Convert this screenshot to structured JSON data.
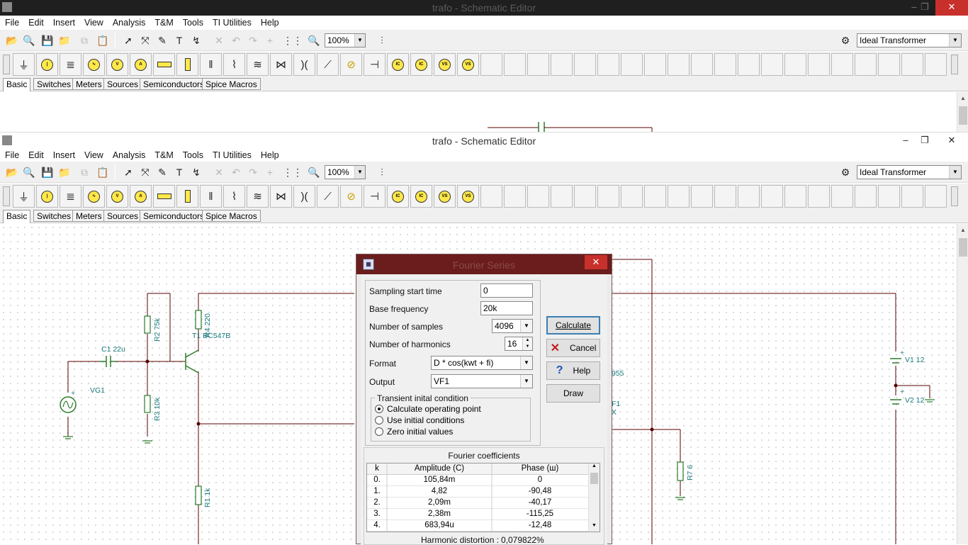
{
  "back_window": {
    "title": "trafo - Schematic Editor",
    "buttons": {
      "minimize": "–",
      "maximize": "❐",
      "close": "✕"
    }
  },
  "window": {
    "title": "trafo - Schematic Editor",
    "buttons": {
      "minimize": "–",
      "maximize": "❐",
      "close": "✕"
    }
  },
  "menu": [
    "File",
    "Edit",
    "Insert",
    "View",
    "Analysis",
    "T&M",
    "Tools",
    "TI Utilities",
    "Help"
  ],
  "toolbar": {
    "zoom": "100%",
    "component_select": "Ideal Transformer"
  },
  "part_tabs": [
    "Basic",
    "Switches",
    "Meters",
    "Sources",
    "Semiconductors",
    "Spice Macros"
  ],
  "schematic_labels": {
    "c1": "C1 22u",
    "vg1": "VG1",
    "r2": "R2 75k",
    "r3": "R3 10k",
    "r4": "R4 220",
    "t1": "T1 BC547B",
    "r1": "R1 1k",
    "r7": "R7 6",
    "v1": "V1 12",
    "v2": "V2 12",
    "partial_955": "955",
    "partial_f1": "F1",
    "partial_x": "X",
    "plus": "+"
  },
  "dialog": {
    "title": "Fourier Series",
    "close": "✕",
    "fields": {
      "sampling_start_label": "Sampling start time",
      "sampling_start_value": "0",
      "base_freq_label": "Base frequency",
      "base_freq_value": "20k",
      "num_samples_label": "Number of samples",
      "num_samples_value": "4096",
      "num_harmonics_label": "Number of harmonics",
      "num_harmonics_value": "16",
      "format_label": "Format",
      "format_value": "D * cos(kwt + fi)",
      "output_label": "Output",
      "output_value": "VF1"
    },
    "transient": {
      "label": "Transient inital condition",
      "options": [
        "Calculate operating point",
        "Use initial conditions",
        "Zero initial values"
      ],
      "selected": 0
    },
    "buttons": {
      "calculate": "Calculate",
      "cancel": "Cancel",
      "help": "Help",
      "draw": "Draw"
    },
    "coefficients": {
      "title": "Fourier coefficients",
      "columns": [
        "k",
        "Amplitude (C)",
        "Phase (ш)"
      ],
      "rows": [
        [
          "0.",
          "105,84m",
          "0"
        ],
        [
          "1.",
          "4,82",
          "-90,48"
        ],
        [
          "2.",
          "2,09m",
          "-40,17"
        ],
        [
          "3.",
          "2,38m",
          "-115,25"
        ],
        [
          "4.",
          "683,94u",
          "-12,48"
        ]
      ]
    },
    "distortion_label": "Harmonic distortion :",
    "distortion_value": "0,079822%"
  }
}
